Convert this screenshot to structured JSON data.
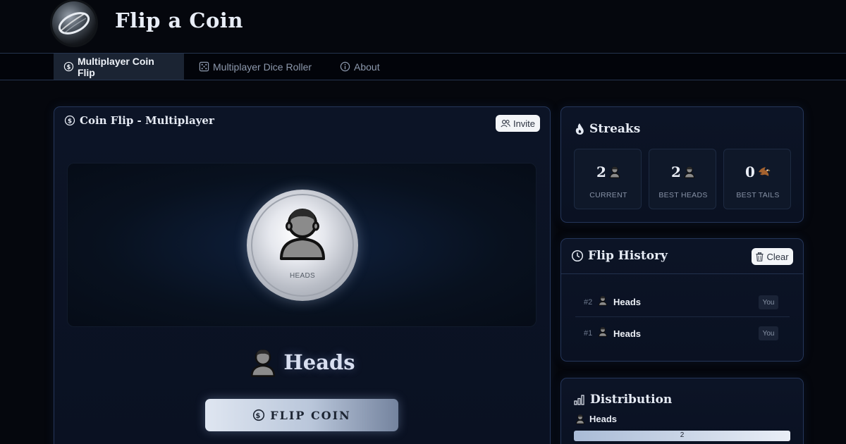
{
  "app": {
    "title": "Flip a Coin"
  },
  "nav": {
    "tabs": [
      {
        "label": "Multiplayer Coin Flip",
        "icon": "coin-icon",
        "active": true
      },
      {
        "label": "Multiplayer Dice Roller",
        "icon": "dice-icon",
        "active": false
      },
      {
        "label": "About",
        "icon": "info-icon",
        "active": false
      }
    ]
  },
  "game": {
    "title": "Coin Flip - Multiplayer",
    "invite_label": "Invite",
    "coin_face_label": "HEADS",
    "result": "Heads",
    "flip_button": "FLIP COIN"
  },
  "streaks": {
    "title": "Streaks",
    "cards": [
      {
        "value": "2",
        "label": "CURRENT",
        "icon": "heads-person-icon"
      },
      {
        "value": "2",
        "label": "BEST HEADS",
        "icon": "heads-person-icon"
      },
      {
        "value": "0",
        "label": "BEST TAILS",
        "icon": "eagle-icon"
      }
    ]
  },
  "history": {
    "title": "Flip History",
    "clear_label": "Clear",
    "rows": [
      {
        "num": "#2",
        "result": "Heads",
        "user": "You"
      },
      {
        "num": "#1",
        "result": "Heads",
        "user": "You"
      }
    ]
  },
  "distribution": {
    "title": "Distribution",
    "items": [
      {
        "label": "Heads",
        "value": "2",
        "fraction": 1.0
      }
    ]
  },
  "colors": {
    "background": "#05070d",
    "panel": "#0c1426",
    "border": "#25365a",
    "accent_light": "#dfe6f1"
  }
}
